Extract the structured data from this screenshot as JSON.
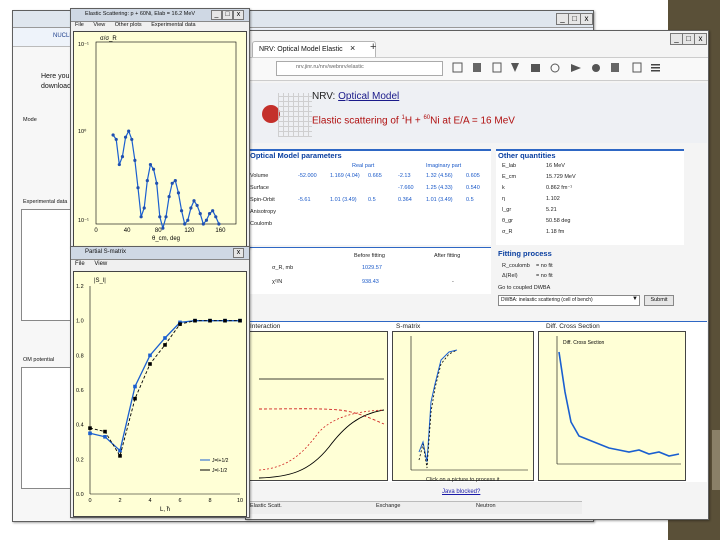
{
  "main_window": {
    "ctrl_min": "_",
    "ctrl_max": "□",
    "ctrl_close": "x",
    "nav_tabs": [
      "NUCLEAR"
    ],
    "partial_text_1": "Here you",
    "partial_text_2": "download",
    "mode_label": "Mode",
    "exp_data_label": "Experimental data",
    "om_potential_label": "OM potential"
  },
  "browser": {
    "tab_title": "NRV: Optical Model Elastic",
    "tab_close": "×",
    "new_tab": "+",
    "url_hint": "nrv.jinr.ru/nrv/webnrv/elastic",
    "page": {
      "heading_prefix": "NRV:",
      "heading_link": "Optical Model",
      "subtitle_text": "Elastic scattering of ",
      "projectile_mass": "1",
      "projectile": "H",
      "plus": " + ",
      "target_mass": "60",
      "target": "Ni",
      "energy_text": " at E/A = 16 MeV",
      "om_params_title": "Optical Model parameters",
      "om_params_sub": "Real part",
      "imag_sub": "Imaginary part",
      "om_rows": [
        {
          "name": "Volume",
          "v": "-52.000",
          "r": "1.169 (4.04)",
          "a": "0.665",
          "w": "-2.13",
          "ri": "1.32 (4.56)",
          "ai": "0.605"
        },
        {
          "name": "Surface",
          "v": "",
          "r": "",
          "a": "",
          "w": "-7.660",
          "ri": "1.25 (4.33)",
          "ai": "0.540"
        },
        {
          "name": "Spin-Orbit",
          "v": "-5.61",
          "r": "1.01 (3.49)",
          "a": "0.5",
          "w": "0.364",
          "ri": "1.01 (3.49)",
          "ai": "0.5"
        },
        {
          "name": "Anisotropy",
          "v": "",
          "r": "",
          "a": "",
          "w": "",
          "ri": "",
          "ai": ""
        },
        {
          "name": "Coulomb",
          "v": "",
          "r": "",
          "a": "",
          "w": "",
          "ri": "",
          "ai": ""
        }
      ],
      "fit_before": "Before fitting",
      "fit_after": "After fitting",
      "fit_row1_label": "σ_R, mb",
      "fit_row1_before": "1029.57",
      "fit_row2_label": "χ²/N",
      "fit_row2_before": "938.43",
      "fit_row2_after": "-",
      "other_title": "Other quantities",
      "other_rows": [
        {
          "k": "E_lab",
          "v": "16 MeV"
        },
        {
          "k": "E_cm",
          "v": "15.729 MeV"
        },
        {
          "k": "k",
          "v": "0.862 fm⁻¹"
        },
        {
          "k": "η",
          "v": "1.102"
        },
        {
          "k": "l_gr",
          "v": "5.21"
        },
        {
          "k": "θ_gr",
          "v": "50.58 deg"
        },
        {
          "k": "σ_R",
          "v": "1.18 fm"
        }
      ],
      "fitting_title": "Fitting process",
      "fitting_rows": [
        {
          "k": "R_coulomb",
          "v": "= no fit"
        },
        {
          "k": "Δ(Rel)",
          "v": "= no fit"
        }
      ],
      "dwba_label": "Go to coupled DWBA",
      "dwba_select": "DWBA: inelastic scattering (cell of bench)",
      "submit": "Submit",
      "sec_interaction": "Interaction",
      "sec_smatrix": "S-matrix",
      "sec_diffcs": "Diff. Cross Section",
      "diffcs_legend": "Diff. Cross Section",
      "click_text": "Click on a picture to process it",
      "java_link": "Java blocked?",
      "status_bits": [
        "Elastic Scatt.",
        "Exchange",
        "Neutron"
      ]
    }
  },
  "popup_scattering": {
    "title": "Elastic Scattering: p + 60Ni, Elab = 16.2 MeV",
    "menu": [
      "File",
      "View",
      "Other plots",
      "Experimental data"
    ],
    "ylabel": "σ/σ_R",
    "xlabel": "θ_cm, deg",
    "x_ticks": [
      "0",
      "40",
      "80",
      "120",
      "160"
    ],
    "y_ticks": [
      "10⁻¹",
      "10⁰",
      "10⁻¹"
    ]
  },
  "popup_partial": {
    "title": "Partial S-matrix",
    "menu": [
      "File",
      "View"
    ],
    "ylabel": "|S_l|",
    "xlabel": "L, ħ",
    "y_ticks": [
      "1.2",
      "1.0",
      "0.8",
      "0.6",
      "0.4",
      "0.2",
      "0.0"
    ],
    "x_ticks": [
      "0",
      "2",
      "4",
      "6",
      "8",
      "10"
    ],
    "legend": [
      "J=l+1/2",
      "J=l-1/2"
    ]
  },
  "chart_data": [
    {
      "type": "scatter",
      "title": "Elastic Scattering",
      "xlabel": "θ_cm, deg",
      "ylabel": "σ/σ_R",
      "xlim": [
        0,
        180
      ],
      "ylim_log10": [
        -1,
        1
      ],
      "scale": "log",
      "series": [
        {
          "x": [
            22,
            26,
            30,
            34,
            38,
            42,
            46,
            50,
            54,
            58,
            62,
            66,
            70,
            74,
            78,
            82,
            86,
            90,
            94,
            98,
            102,
            106,
            110,
            114,
            118,
            122,
            126,
            130,
            134,
            138,
            142,
            146,
            150,
            154,
            158
          ],
          "values": [
            0.95,
            0.85,
            0.45,
            0.55,
            0.9,
            1.05,
            0.85,
            0.5,
            0.25,
            0.12,
            0.15,
            0.3,
            0.45,
            0.4,
            0.28,
            0.12,
            0.09,
            0.12,
            0.2,
            0.28,
            0.3,
            0.22,
            0.14,
            0.1,
            0.11,
            0.15,
            0.18,
            0.16,
            0.13,
            0.1,
            0.11,
            0.13,
            0.14,
            0.12,
            0.1
          ]
        }
      ]
    },
    {
      "type": "line",
      "title": "Partial S-matrix",
      "xlabel": "L, ħ",
      "ylabel": "|S_l|",
      "xlim": [
        0,
        10
      ],
      "ylim": [
        0,
        1.2
      ],
      "series": [
        {
          "name": "J=l+1/2",
          "x": [
            0,
            1,
            2,
            3,
            4,
            5,
            6,
            7,
            8,
            9,
            10
          ],
          "values": [
            0.35,
            0.33,
            0.25,
            0.62,
            0.8,
            0.9,
            0.99,
            1.0,
            1.0,
            1.0,
            1.0
          ]
        },
        {
          "name": "J=l-1/2",
          "x": [
            0,
            1,
            2,
            3,
            4,
            5,
            6,
            7,
            8,
            9,
            10
          ],
          "values": [
            0.38,
            0.36,
            0.22,
            0.55,
            0.75,
            0.86,
            0.98,
            1.0,
            1.0,
            1.0,
            1.0
          ]
        }
      ]
    }
  ]
}
